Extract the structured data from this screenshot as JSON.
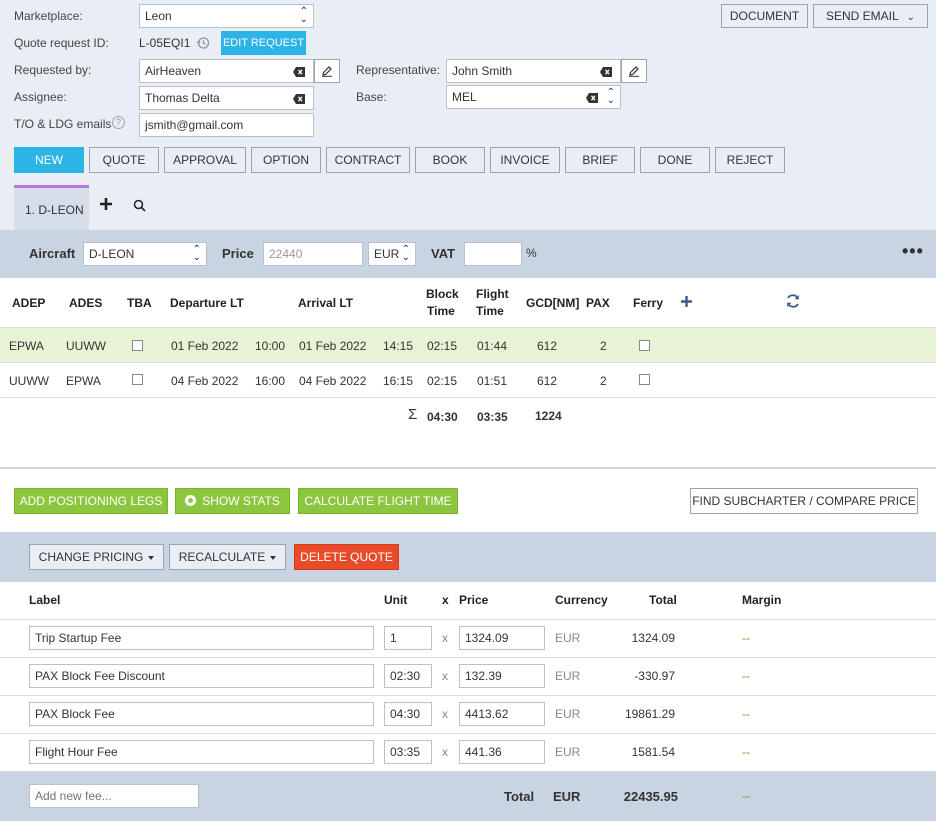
{
  "form": {
    "marketplace_label": "Marketplace:",
    "marketplace_value": "Leon",
    "quote_request_label": "Quote request ID:",
    "quote_request_value": "L-05EQI1",
    "edit_request_label": "EDIT REQUEST",
    "requested_by_label": "Requested by:",
    "requested_by_value": "AirHeaven",
    "representative_label": "Representative:",
    "representative_value": "John Smith",
    "assignee_label": "Assignee:",
    "assignee_value": "Thomas Delta",
    "base_label": "Base:",
    "base_value": "MEL",
    "emails_label": "T/O & LDG emails",
    "emails_value": "jsmith@gmail.com"
  },
  "top_actions": {
    "document_label": "DOCUMENT",
    "send_email_label": "SEND EMAIL"
  },
  "status_buttons": [
    "NEW",
    "QUOTE",
    "APPROVAL",
    "OPTION",
    "CONTRACT",
    "BOOK",
    "INVOICE",
    "BRIEF",
    "DONE",
    "REJECT"
  ],
  "tabs": {
    "active_label": "1. D-LEON"
  },
  "aircraft_bar": {
    "aircraft_label": "Aircraft",
    "aircraft_value": "D-LEON",
    "price_label": "Price",
    "price_placeholder": "22440",
    "currency_value": "EUR",
    "vat_label": "VAT",
    "vat_value": "",
    "percent": "%"
  },
  "legs_table": {
    "headers": {
      "adep": "ADEP",
      "ades": "ADES",
      "tba": "TBA",
      "departure": "Departure LT",
      "arrival": "Arrival LT",
      "block_time_1": "Block",
      "block_time_2": "Time",
      "flight_time_1": "Flight",
      "flight_time_2": "Time",
      "gcd": "GCD[NM]",
      "pax": "PAX",
      "ferry": "Ferry"
    },
    "rows": [
      {
        "adep": "EPWA",
        "ades": "UUWW",
        "dep_date": "01 Feb 2022",
        "dep_time": "10:00",
        "arr_date": "01 Feb 2022",
        "arr_time": "14:15",
        "block": "02:15",
        "flight": "01:44",
        "gcd": "612",
        "pax": "2"
      },
      {
        "adep": "UUWW",
        "ades": "EPWA",
        "dep_date": "04 Feb 2022",
        "dep_time": "16:00",
        "arr_date": "04 Feb 2022",
        "arr_time": "16:15",
        "block": "02:15",
        "flight": "01:51",
        "gcd": "612",
        "pax": "2"
      }
    ],
    "totals": {
      "sigma": "Σ",
      "block": "04:30",
      "flight": "03:35",
      "gcd": "1224"
    }
  },
  "leg_actions": {
    "add_positioning": "ADD POSITIONING LEGS",
    "show_stats": "SHOW STATS",
    "calculate_flight_time": "CALCULATE FLIGHT TIME",
    "find_subcharter": "FIND SUBCHARTER / COMPARE PRICE"
  },
  "pricing_actions": {
    "change_pricing": "CHANGE PRICING",
    "recalculate": "RECALCULATE",
    "delete_quote": "DELETE QUOTE"
  },
  "fees_table": {
    "headers": {
      "label": "Label",
      "unit": "Unit",
      "x": "x",
      "price": "Price",
      "currency": "Currency",
      "total": "Total",
      "margin": "Margin"
    },
    "rows": [
      {
        "label": "Trip Startup Fee",
        "unit": "1",
        "x": "x",
        "price": "1324.09",
        "currency": "EUR",
        "total": "1324.09",
        "margin": "--"
      },
      {
        "label": "PAX Block Fee Discount",
        "unit": "02:30",
        "x": "x",
        "price": "132.39",
        "currency": "EUR",
        "total": "-330.97",
        "margin": "--"
      },
      {
        "label": "PAX Block Fee",
        "unit": "04:30",
        "x": "x",
        "price": "4413.62",
        "currency": "EUR",
        "total": "19861.29",
        "margin": "--"
      },
      {
        "label": "Flight Hour Fee",
        "unit": "03:35",
        "x": "x",
        "price": "441.36",
        "currency": "EUR",
        "total": "1581.54",
        "margin": "--"
      }
    ],
    "footer": {
      "add_fee_placeholder": "Add new fee...",
      "total_label": "Total",
      "currency": "EUR",
      "total_value": "22435.95",
      "margin": "--"
    }
  }
}
